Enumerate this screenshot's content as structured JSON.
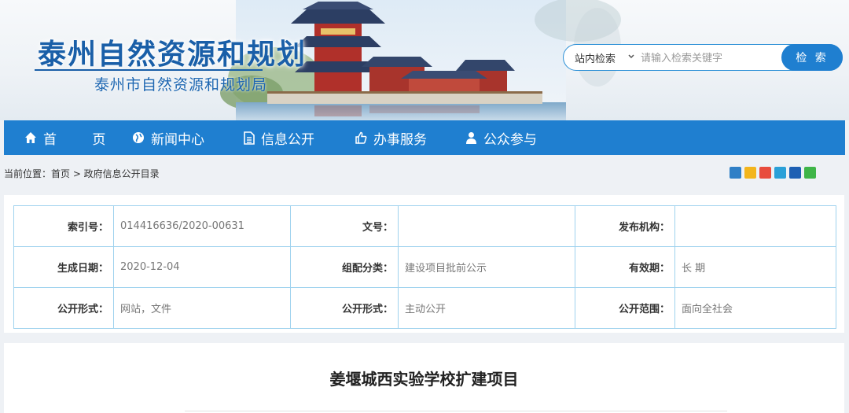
{
  "header": {
    "site_title": "泰州自然资源和规划",
    "site_subtitle": "泰州市自然资源和规划局"
  },
  "search": {
    "scope": "站内检索",
    "placeholder": "请输入检索关键字",
    "button": "检 索"
  },
  "nav": {
    "items": [
      {
        "label": "首 页",
        "icon": "home-icon"
      },
      {
        "label": "新闻中心",
        "icon": "globe-icon"
      },
      {
        "label": "信息公开",
        "icon": "document-icon"
      },
      {
        "label": "办事服务",
        "icon": "thumbs-up-icon"
      },
      {
        "label": "公众参与",
        "icon": "user-icon"
      }
    ]
  },
  "breadcrumb": "当前位置：首页 > 政府信息公开目录",
  "share_icons": [
    "plus-icon",
    "qzone-icon",
    "weibo-icon",
    "tencent-weibo-icon",
    "renren-icon",
    "wechat-icon"
  ],
  "meta": {
    "rows": [
      [
        {
          "label": "索引号：",
          "value": "014416636/2020-00631"
        },
        {
          "label": "文号：",
          "value": ""
        },
        {
          "label": "发布机构：",
          "value": ""
        }
      ],
      [
        {
          "label": "生成日期：",
          "value": "2020-12-04"
        },
        {
          "label": "组配分类：",
          "value": "建设项目批前公示"
        },
        {
          "label": "有效期：",
          "value": "长 期"
        }
      ],
      [
        {
          "label": "公开形式：",
          "value": "网站，文件"
        },
        {
          "label": "公开形式：",
          "value": "主动公开"
        },
        {
          "label": "公开范围：",
          "value": "面向全社会"
        }
      ]
    ]
  },
  "document": {
    "title": "姜堰城西实验学校扩建项目"
  },
  "colors": {
    "nav_bg": "#1f7fd0",
    "title_blue": "#1a5fa8",
    "table_border": "#9fd2ee"
  }
}
